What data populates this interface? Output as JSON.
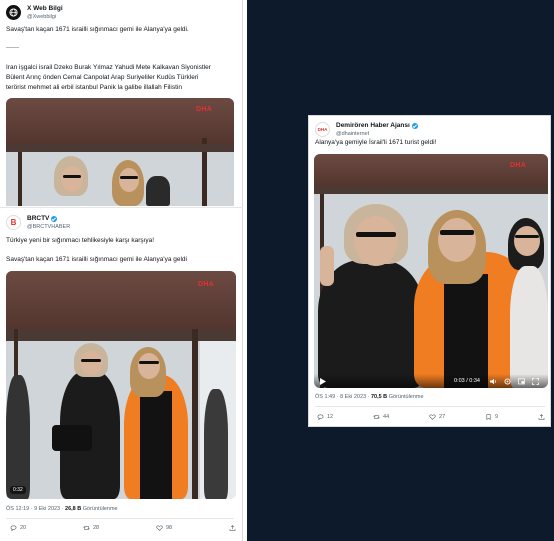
{
  "post1": {
    "name": "X Web Bilgi",
    "handle": "@Xwebbilgi",
    "line1": "Savaş'tan kaçan 1671 israilli sığınmacı gemi ile Alanya'ya geldi.",
    "divider": "——",
    "tags": [
      "Iran işgalci israil Dzeko Burak Yılmaz Yahudi Mete Kalkavan Siyonistler",
      "Bülent Arınç önden Cemal Canpolat Arap Suriyeliler Kudüs Türkleri",
      "terörist mehmet ali erbil istanbul  Panik la galibe illallah Filistin"
    ],
    "watermark": "DHA"
  },
  "post2": {
    "name": "BRCTV",
    "handle": "@BRCTVHABER",
    "avatar_text": "B",
    "line1": "Türkiye yeni bir sığınmacı tehlikesiyle karşı karşıya!",
    "line2": "Savaş'tan kaçan 1671 israilli sığınmacı gemi ile Alanya'ya geldi",
    "watermark": "DHA",
    "video_time": "0:32",
    "time": "ÖS 12:19 · 9 Eki 2023 · ",
    "views": "26,8 B",
    "views_label": " Görüntülenme",
    "replies": "20",
    "reposts": "28",
    "likes": "98"
  },
  "post3": {
    "name": "Demirören Haber Ajansı",
    "handle": "@dhainternet",
    "avatar_text": "DHA",
    "text": "Alanya'ya gemiyle İsrail'li 1671 turist geldi!",
    "watermark": "DHA",
    "video_time": "0:03 / 0:34",
    "time": "ÖS 1:49 · 8 Eki 2023 · ",
    "views": "70,5 B",
    "views_label": " Görüntülenme",
    "replies": "12",
    "reposts": "44",
    "likes": "27",
    "bookmarks": "9"
  },
  "colors": {
    "orange": "#f07d22",
    "black_shirt": "#1b1b1b",
    "verified": "#1d9bf0",
    "brand_red": "#e3312e",
    "page_dark": "#0d1a2b"
  }
}
